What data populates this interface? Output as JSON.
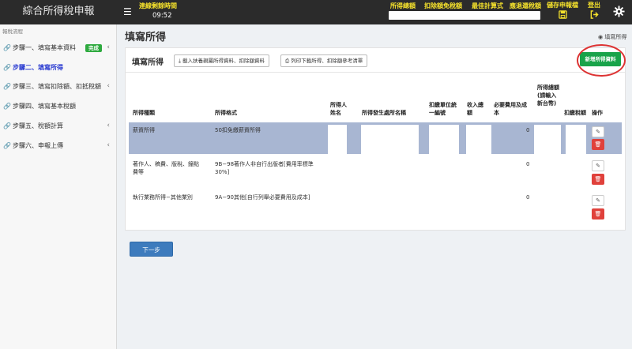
{
  "app": {
    "title": "綜合所得稅申報"
  },
  "topbar": {
    "menu_icon": "hamburger-icon",
    "timer_label": "連線剩餘時間",
    "timer_value": "09:52",
    "stats": [
      "所得總額",
      "扣除額免稅額",
      "最佳計算式",
      "應退還稅額"
    ],
    "save_label": "儲存申報檔",
    "logout_label": "登出",
    "highlight_color": "#f6e22c"
  },
  "sidebar": {
    "title": "報稅流程",
    "items": [
      {
        "label": "步驟一、填寫基本資料",
        "badge": "完成",
        "chevron": "‹",
        "active": false
      },
      {
        "label": "步驟二、填寫所得",
        "active": true
      },
      {
        "label": "步驟三、填寫扣除額、扣抵稅額",
        "chevron": "‹",
        "active": false
      },
      {
        "label": "步驟四、填寫基本稅額",
        "active": false
      },
      {
        "label": "步驟五、稅額計算",
        "chevron": "‹",
        "active": false
      },
      {
        "label": "步驟六、申報上傳",
        "chevron": "‹",
        "active": false
      }
    ]
  },
  "main": {
    "page_title": "填寫所得",
    "breadcrumb": "填寫所得",
    "panel_title": "填寫所得",
    "import_button": "載入扶養親屬所得資料、扣除額資料",
    "print_button": "列印下載所得、扣除額參考清單",
    "add_button": "新增所得資料",
    "next_button": "下一步"
  },
  "table": {
    "headers": [
      "所得種類",
      "所得格式",
      "所得人姓名",
      "所得發生處所名稱",
      "扣繳單位統一編號",
      "收入總額",
      "必要費用及成本",
      "所得總額(請輸入新台幣)",
      "扣繳稅額",
      "操作"
    ],
    "rows": [
      {
        "type": "薪資所得",
        "format": "50扣免繳薪資所得",
        "cost": "0",
        "selected": true
      },
      {
        "type": "著作人、稿費、版稅、鐘點費等",
        "format": "9B−98著作人非自行出版者[費用率標準30%]",
        "cost": "0",
        "selected": false
      },
      {
        "type": "執行業務所得−其他業別",
        "format": "9A−90其他[自行列舉必要費用及成本]",
        "cost": "0",
        "selected": false
      }
    ]
  },
  "colors": {
    "accent": "#2a3bd1",
    "add_green": "#19a34a",
    "delete_red": "#e0413b",
    "selected_row": "#a8b6d2",
    "next_blue": "#3d7bbd"
  }
}
